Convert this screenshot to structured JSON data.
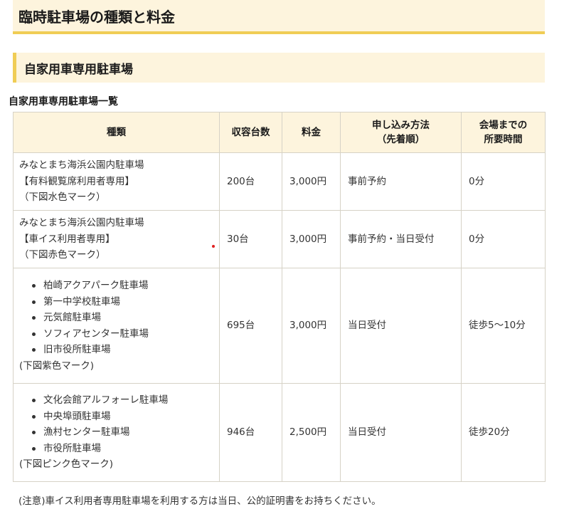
{
  "page": {
    "title": "臨時駐車場の種類と料金",
    "section_title": "自家用車専用駐車場",
    "list_title": "自家用車専用駐車場一覧"
  },
  "table": {
    "headers": {
      "type": "種類",
      "capacity": "収容台数",
      "fee": "料金",
      "method_line1": "申し込み方法",
      "method_line2": "（先着順）",
      "time_line1": "会場までの",
      "time_line2": "所要時間"
    },
    "rows": [
      {
        "name_line1": "みなとまち海浜公園内駐車場",
        "name_line2": "【有料観覧席利用者専用】",
        "mark": "（下図水色マーク）",
        "capacity": "200台",
        "fee": "3,000円",
        "method": "事前予約",
        "time": "0分"
      },
      {
        "name_line1": "みなとまち海浜公園内駐車場",
        "name_line2": "【車イス利用者専用】",
        "mark": "（下図赤色マーク）",
        "capacity": "30台",
        "fee": "3,000円",
        "method": "事前予約・当日受付",
        "time": "0分"
      },
      {
        "lots": [
          "柏崎アクアパーク駐車場",
          "第一中学校駐車場",
          "元気館駐車場",
          "ソフィアセンター駐車場",
          "旧市役所駐車場"
        ],
        "mark": "(下図紫色マーク)",
        "capacity": "695台",
        "fee": "3,000円",
        "method": "当日受付",
        "time": "徒歩5～10分"
      },
      {
        "lots": [
          "文化会館アルフォーレ駐車場",
          "中央埠頭駐車場",
          "漁村センター駐車場",
          "市役所駐車場"
        ],
        "mark": "(下図ピンク色マーク)",
        "capacity": "946台",
        "fee": "2,500円",
        "method": "当日受付",
        "time": "徒歩20分"
      }
    ]
  },
  "note": "(注意)車イス利用者専用駐車場を利用する方は当日、公的証明書をお持ちください。",
  "colors": {
    "heading_bg": "#fdf4dd",
    "accent": "#f0cd55",
    "border": "#d6d2c6",
    "red_marker": "#e02020"
  }
}
